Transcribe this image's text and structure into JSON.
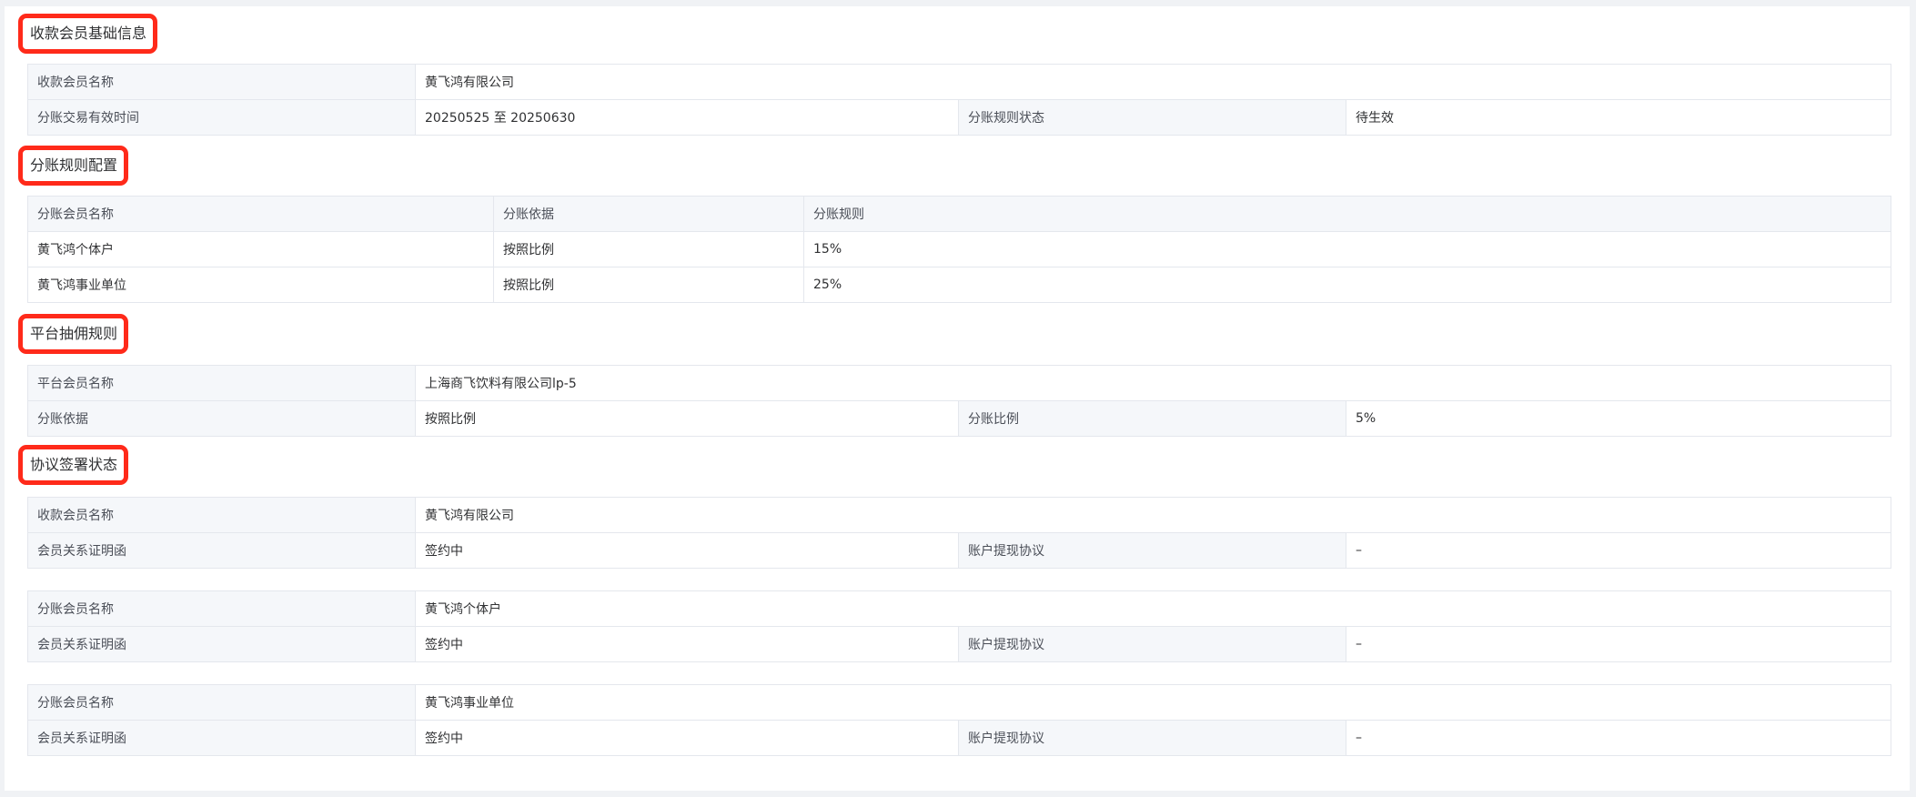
{
  "sections": {
    "basic": {
      "title": "收款会员基础信息",
      "member_name_label": "收款会员名称",
      "member_name": "黄飞鸿有限公司",
      "valid_time_label": "分账交易有效时间",
      "valid_time": "20250525 至 20250630",
      "rule_status_label": "分账规则状态",
      "rule_status": "待生效"
    },
    "rules": {
      "title": "分账规则配置",
      "columns": [
        "分账会员名称",
        "分账依据",
        "分账规则"
      ],
      "rows": [
        {
          "name": "黄飞鸿个体户",
          "basis": "按照比例",
          "rule": "15%"
        },
        {
          "name": "黄飞鸿事业单位",
          "basis": "按照比例",
          "rule": "25%"
        }
      ]
    },
    "platform": {
      "title": "平台抽佣规则",
      "member_name_label": "平台会员名称",
      "member_name": "上海商飞饮料有限公司lp-5",
      "basis_label": "分账依据",
      "basis": "按照比例",
      "ratio_label": "分账比例",
      "ratio": "5%"
    },
    "agreement": {
      "title": "协议签署状态",
      "groups": [
        {
          "name_label": "收款会员名称",
          "name": "黄飞鸿有限公司",
          "relation_label": "会员关系证明函",
          "relation_status": "签约中",
          "withdraw_label": "账户提现协议",
          "withdraw_status": "–"
        },
        {
          "name_label": "分账会员名称",
          "name": "黄飞鸿个体户",
          "relation_label": "会员关系证明函",
          "relation_status": "签约中",
          "withdraw_label": "账户提现协议",
          "withdraw_status": "–"
        },
        {
          "name_label": "分账会员名称",
          "name": "黄飞鸿事业单位",
          "relation_label": "会员关系证明函",
          "relation_status": "签约中",
          "withdraw_label": "账户提现协议",
          "withdraw_status": "–"
        }
      ]
    }
  },
  "colors": {
    "highlight_border": "#ff2a1a",
    "label_bg": "#f5f7fa",
    "border": "#e4e7ed",
    "page_bg": "#f0f2f5"
  }
}
